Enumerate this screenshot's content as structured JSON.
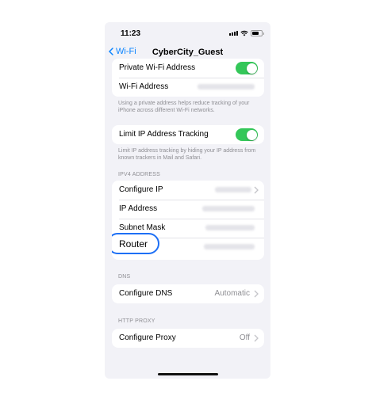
{
  "status_bar": {
    "time": "11:23"
  },
  "nav": {
    "back_label": "Wi-Fi",
    "title": "CyberCity_Guest"
  },
  "privacy_group": {
    "private_address_label": "Private Wi-Fi Address",
    "private_address_enabled": true,
    "wifi_address_label": "Wi-Fi Address",
    "footer": "Using a private address helps reduce tracking of your iPhone across different Wi-Fi networks."
  },
  "limit_ip": {
    "label": "Limit IP Address Tracking",
    "enabled": true,
    "footer": "Limit IP address tracking by hiding your IP address from known trackers in Mail and Safari."
  },
  "ipv4": {
    "header": "IPV4 ADDRESS",
    "rows": [
      {
        "label": "Configure IP"
      },
      {
        "label": "IP Address"
      },
      {
        "label": "Subnet Mask"
      },
      {
        "label": "Router"
      }
    ]
  },
  "dns": {
    "header": "DNS",
    "configure_label": "Configure DNS",
    "configure_value": "Automatic"
  },
  "proxy": {
    "header": "HTTP PROXY",
    "configure_label": "Configure Proxy",
    "configure_value": "Off"
  },
  "colors": {
    "accent": "#0a84ff",
    "toggle_on": "#34c759",
    "callout": "#1d6ff5",
    "background": "#f2f2f7"
  }
}
